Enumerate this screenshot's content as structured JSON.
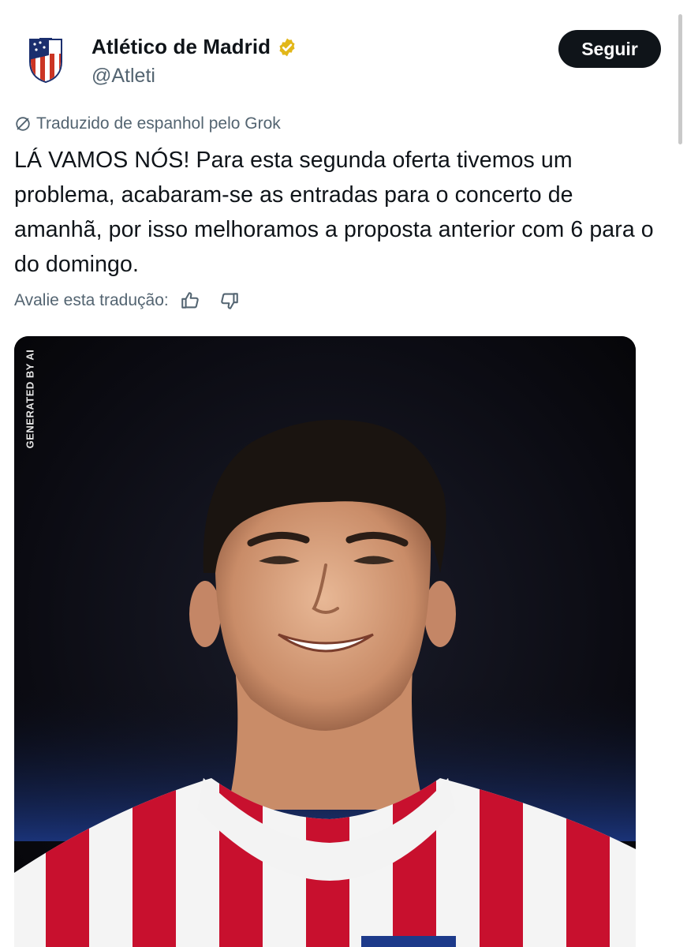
{
  "account": {
    "name": "Atlético de Madrid",
    "handle": "@Atleti",
    "avatar_icon": "atletico-crest-icon",
    "verified_icon": "gold-verified-badge-icon",
    "verified_color": "#e2b719"
  },
  "actions": {
    "follow_label": "Seguir"
  },
  "translation": {
    "note": "Traduzido de espanhol pelo Grok",
    "note_icon": "grok-icon"
  },
  "tweet": {
    "text": "LÁ VAMOS NÓS! Para esta segunda oferta tivemos um problema, acabaram-se as entradas para o concerto de amanhã, por isso melhoramos a proposta anterior com 6 para o do domingo."
  },
  "rating": {
    "label": "Avalie esta tradução:",
    "like_icon": "thumbs-up-icon",
    "dislike_icon": "thumbs-down-icon"
  },
  "media": {
    "watermark": "GENERATED BY AI",
    "kind": "photo of smiling young man in red-white striped jersey"
  },
  "colors": {
    "text": "#0f1419",
    "secondary": "#536471",
    "button_bg": "#0f1419",
    "button_text": "#ffffff",
    "jersey_red": "#c8102e"
  }
}
